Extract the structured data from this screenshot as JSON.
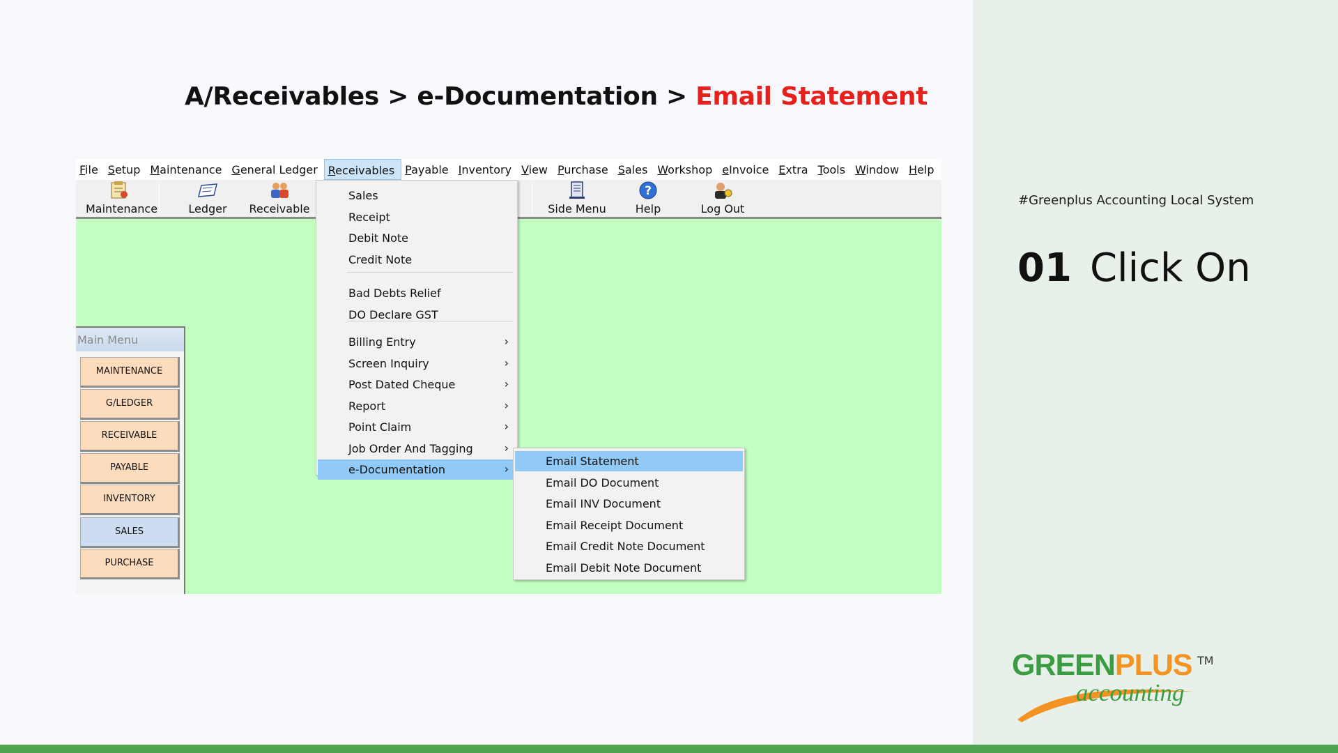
{
  "header": {
    "breadcrumb_part1": "A/Receivables >  e-Documentation > ",
    "breadcrumb_highlight": "Email Statement"
  },
  "sidebar_info": {
    "tagline": "#Greenplus Accounting Local System",
    "step_number": "01",
    "step_text": "Click On"
  },
  "app": {
    "menubar": [
      {
        "label": "File"
      },
      {
        "label": "Setup"
      },
      {
        "label": "Maintenance"
      },
      {
        "label": "General Ledger"
      },
      {
        "label": "Receivables",
        "active": true
      },
      {
        "label": "Payable"
      },
      {
        "label": "Inventory"
      },
      {
        "label": "View"
      },
      {
        "label": "Purchase"
      },
      {
        "label": "Sales"
      },
      {
        "label": "Workshop"
      },
      {
        "label": "eInvoice"
      },
      {
        "label": "Extra"
      },
      {
        "label": "Tools"
      },
      {
        "label": "Window"
      },
      {
        "label": "Help"
      }
    ],
    "toolbar": {
      "maintenance": "Maintenance",
      "ledger": "Ledger",
      "receivable": "Receivable",
      "side_menu": "Side Menu",
      "help": "Help",
      "log_out": "Log Out"
    },
    "main_menu": {
      "title": "Main Menu",
      "buttons": [
        "MAINTENANCE",
        "G/LEDGER",
        "RECEIVABLE",
        "PAYABLE",
        "INVENTORY",
        "SALES",
        "PURCHASE"
      ],
      "selected": "SALES"
    },
    "receivables_menu": {
      "group1": [
        "Sales",
        "Receipt",
        "Debit Note",
        "Credit Note"
      ],
      "group2": [
        "Bad Debts Relief",
        "DO Declare GST"
      ],
      "group3": [
        "Billing Entry",
        "Screen Inquiry",
        "Post Dated Cheque",
        "Report",
        "Point Claim",
        "Job Order And Tagging",
        "e-Documentation"
      ],
      "highlighted": "e-Documentation"
    },
    "edoc_menu": {
      "items": [
        "Email Statement",
        "Email DO Document",
        "Email INV Document",
        "Email Receipt Document",
        "Email Credit Note Document",
        "Email Debit Note Document"
      ],
      "highlighted": "Email Statement"
    }
  },
  "logo": {
    "brand_part1": "GREEN",
    "brand_part2": "PLUS",
    "trademark": "TM",
    "subtitle": "accounting"
  },
  "colors": {
    "highlight_red": "#e8201c",
    "workspace_green": "#c3ffc1",
    "brand_green": "#3a9d42",
    "brand_orange": "#f39323",
    "menu_highlight": "#91c9f7"
  }
}
